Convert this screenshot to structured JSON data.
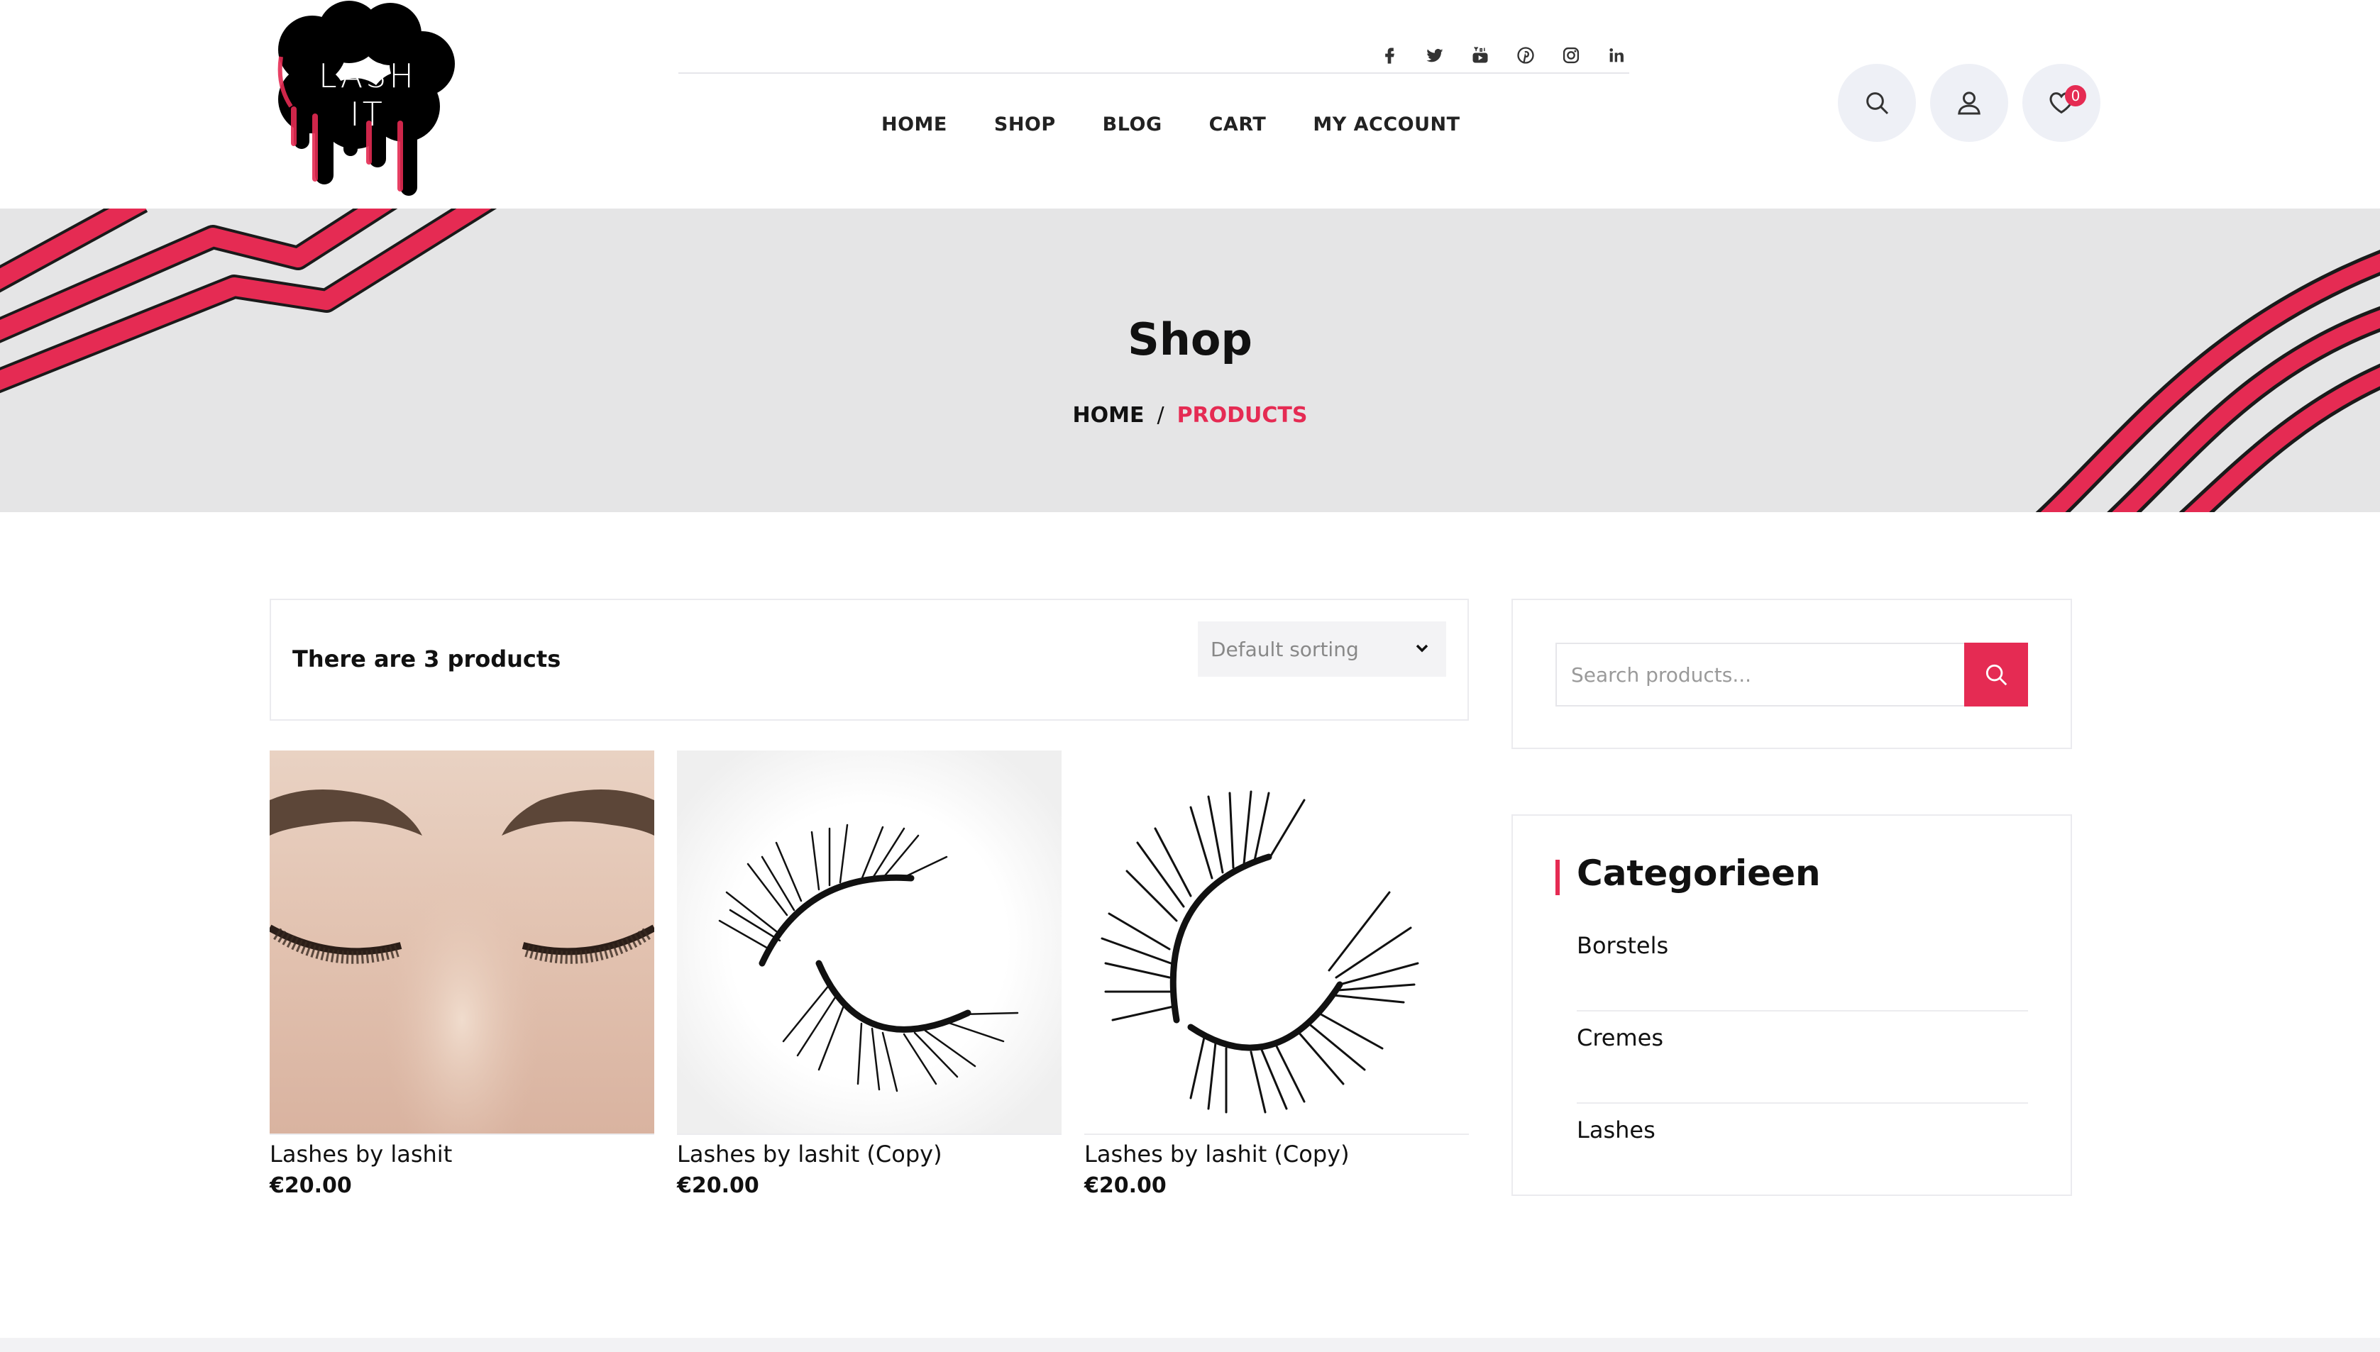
{
  "brand": {
    "logo_text": "LASH IT",
    "accent_color": "#e52b53",
    "logo_color": "#000000"
  },
  "header": {
    "social_icons": [
      "facebook-icon",
      "twitter-icon",
      "youtube-icon",
      "pinterest-icon",
      "instagram-icon",
      "linkedin-icon"
    ],
    "nav": [
      {
        "label": "HOME"
      },
      {
        "label": "SHOP"
      },
      {
        "label": "BLOG"
      },
      {
        "label": "CART"
      },
      {
        "label": "MY ACCOUNT"
      }
    ],
    "wishlist_count": "0"
  },
  "banner": {
    "title": "Shop",
    "breadcrumb": {
      "home": "HOME",
      "separator": "/",
      "current": "PRODUCTS"
    }
  },
  "shop": {
    "result_count": "There are 3 products",
    "sorting": {
      "selected": "Default sorting"
    },
    "products": [
      {
        "name": "Lashes by lashit",
        "price": "€20.00"
      },
      {
        "name": "Lashes by lashit (Copy)",
        "price": "€20.00"
      },
      {
        "name": "Lashes by lashit (Copy)",
        "price": "€20.00"
      }
    ]
  },
  "sidebar": {
    "search": {
      "placeholder": "Search products..."
    },
    "categories": {
      "title": "Categorieen",
      "items": [
        {
          "label": "Borstels"
        },
        {
          "label": "Cremes"
        },
        {
          "label": "Lashes"
        }
      ]
    }
  }
}
